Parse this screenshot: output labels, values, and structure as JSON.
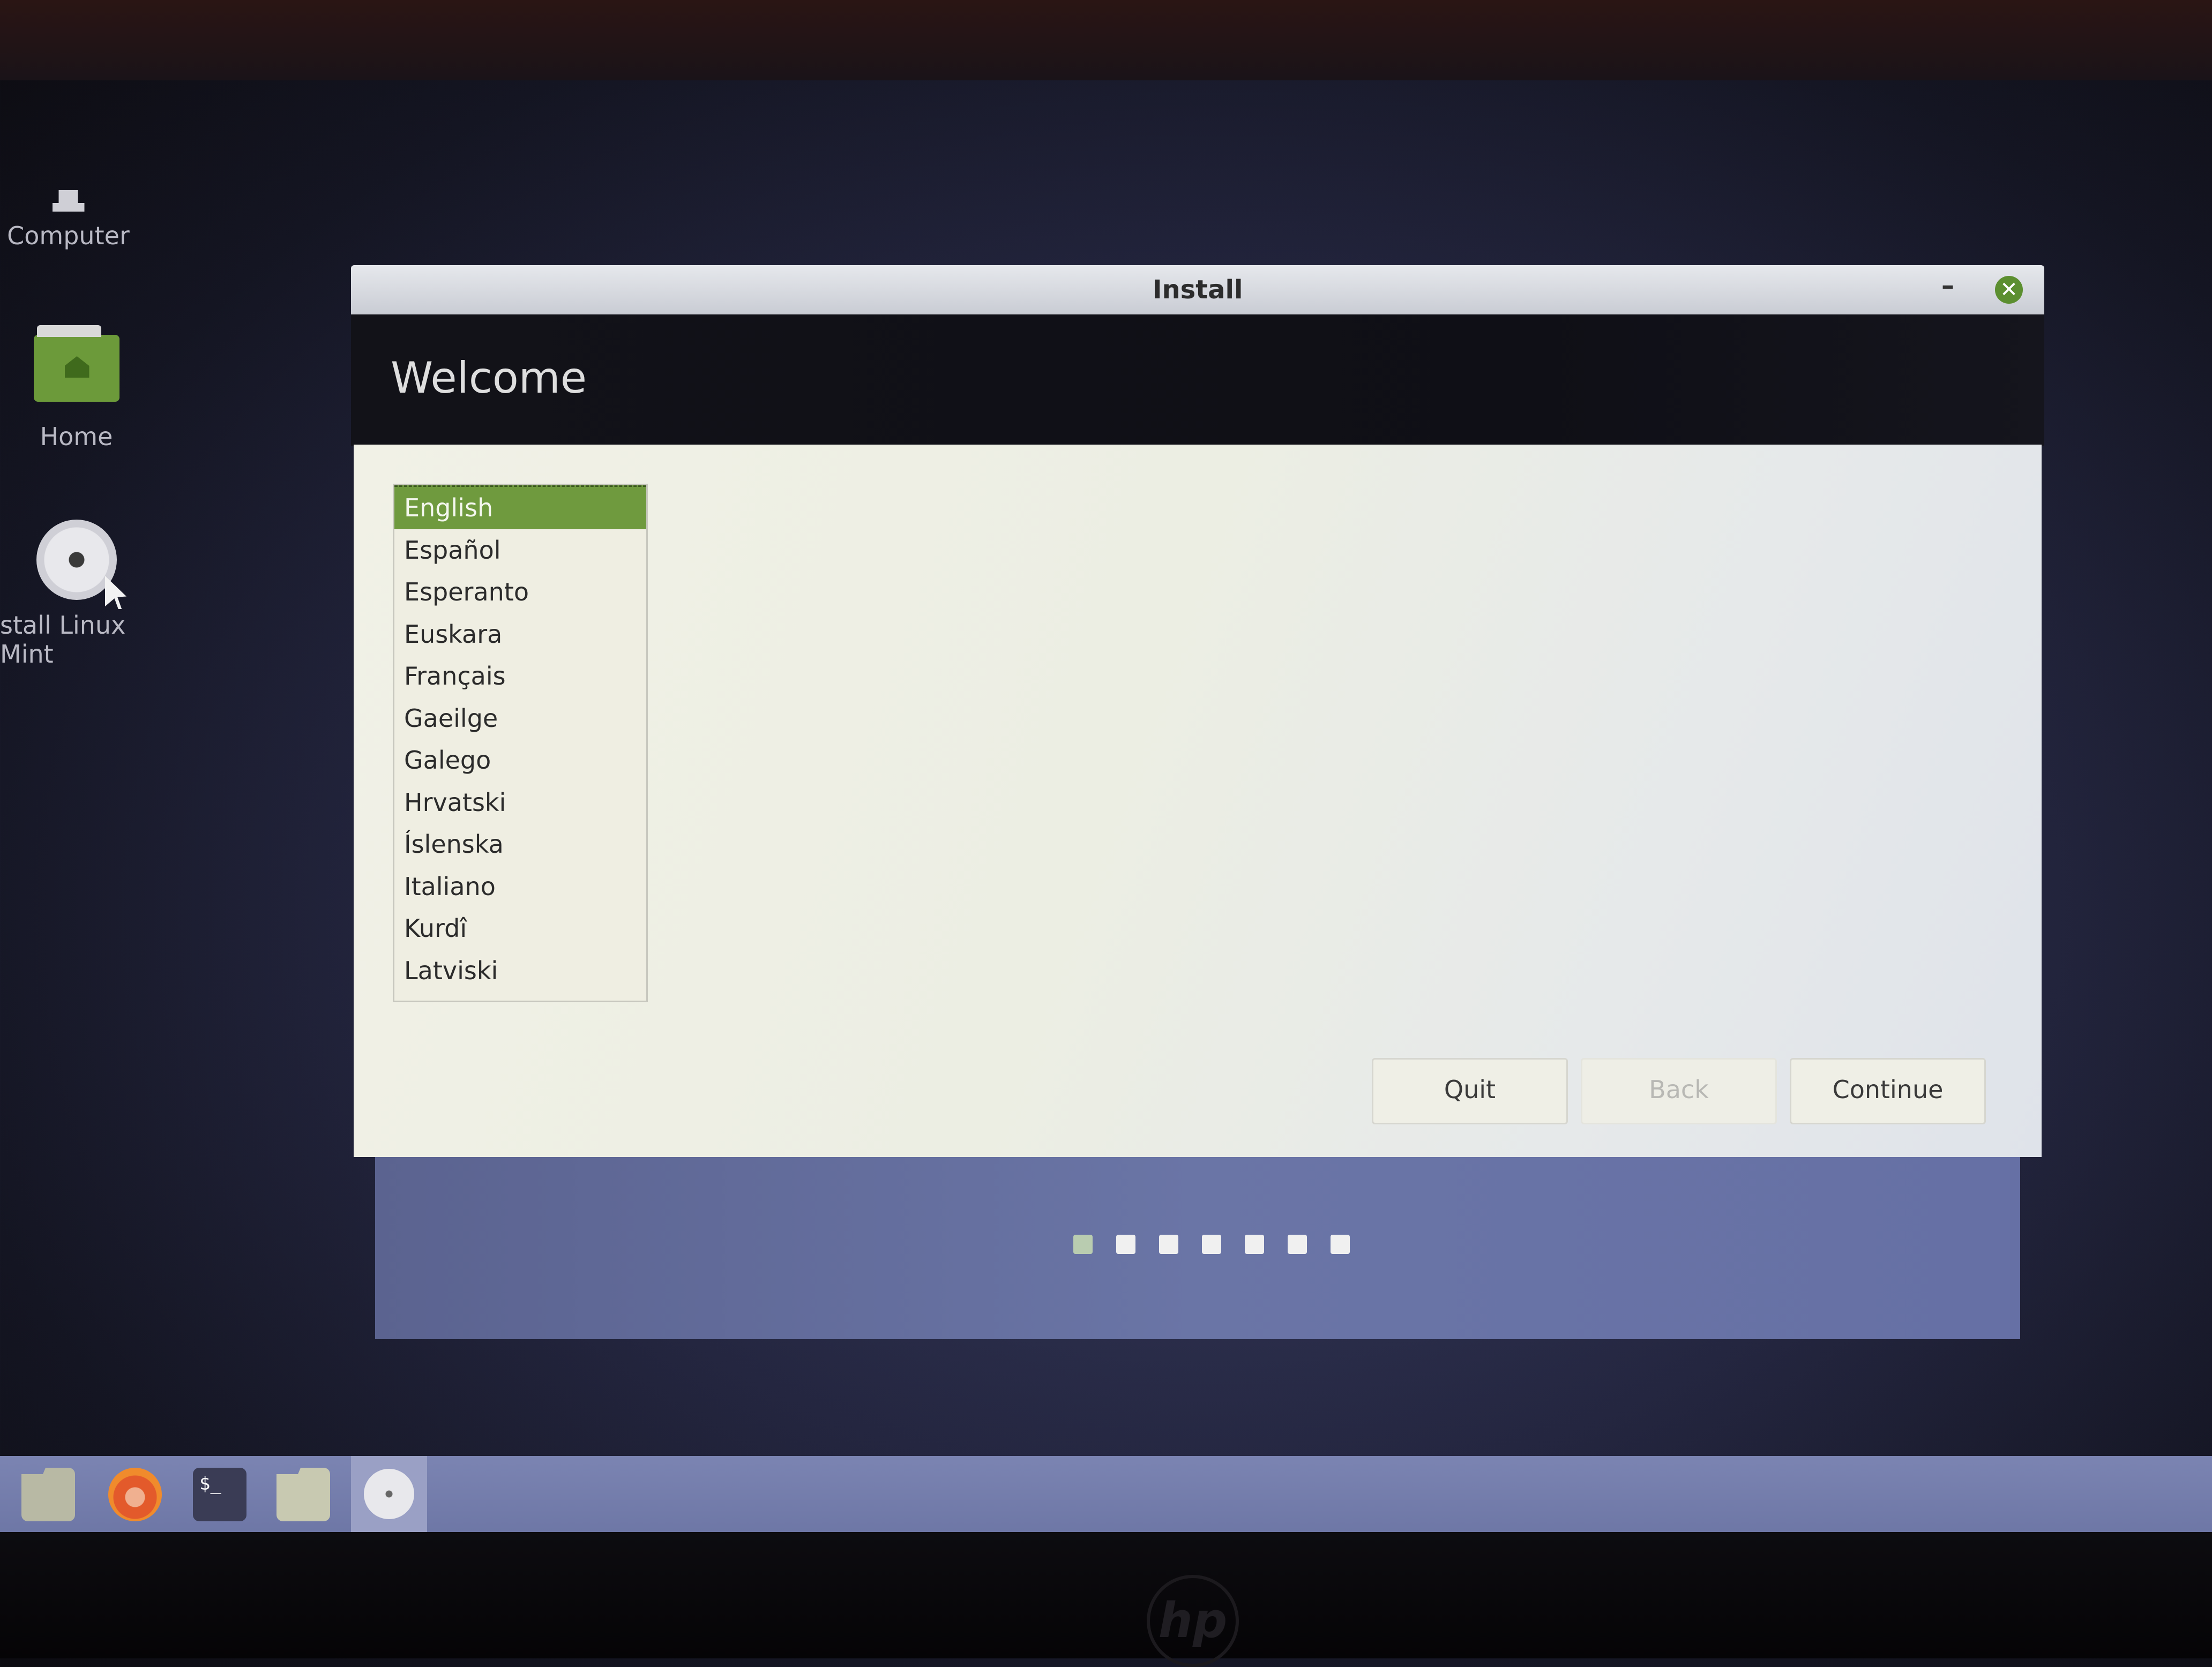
{
  "desktop": {
    "icons": [
      {
        "label": "Computer"
      },
      {
        "label": "Home"
      },
      {
        "label": "stall Linux Mint"
      }
    ]
  },
  "window": {
    "title": "Install",
    "minimize_glyph": "–",
    "close_glyph": "✕",
    "heading": "Welcome",
    "languages": [
      "English",
      "Español",
      "Esperanto",
      "Euskara",
      "Français",
      "Gaeilge",
      "Galego",
      "Hrvatski",
      "Íslenska",
      "Italiano",
      "Kurdî",
      "Latviski"
    ],
    "selected_language": "English",
    "buttons": {
      "quit": "Quit",
      "back": "Back",
      "continue": "Continue"
    },
    "progress": {
      "total_steps": 7,
      "current_step": 1
    }
  },
  "taskbar": {
    "items": [
      "files-icon",
      "firefox-icon",
      "terminal-icon",
      "folder-icon",
      "install-disc-icon"
    ],
    "terminal_glyph": "$_"
  },
  "monitor": {
    "brand_logo": "hp"
  },
  "colors": {
    "accent_green": "#6f9a3e",
    "taskbar": "#7b84b2",
    "footer": "#6a75a6"
  }
}
